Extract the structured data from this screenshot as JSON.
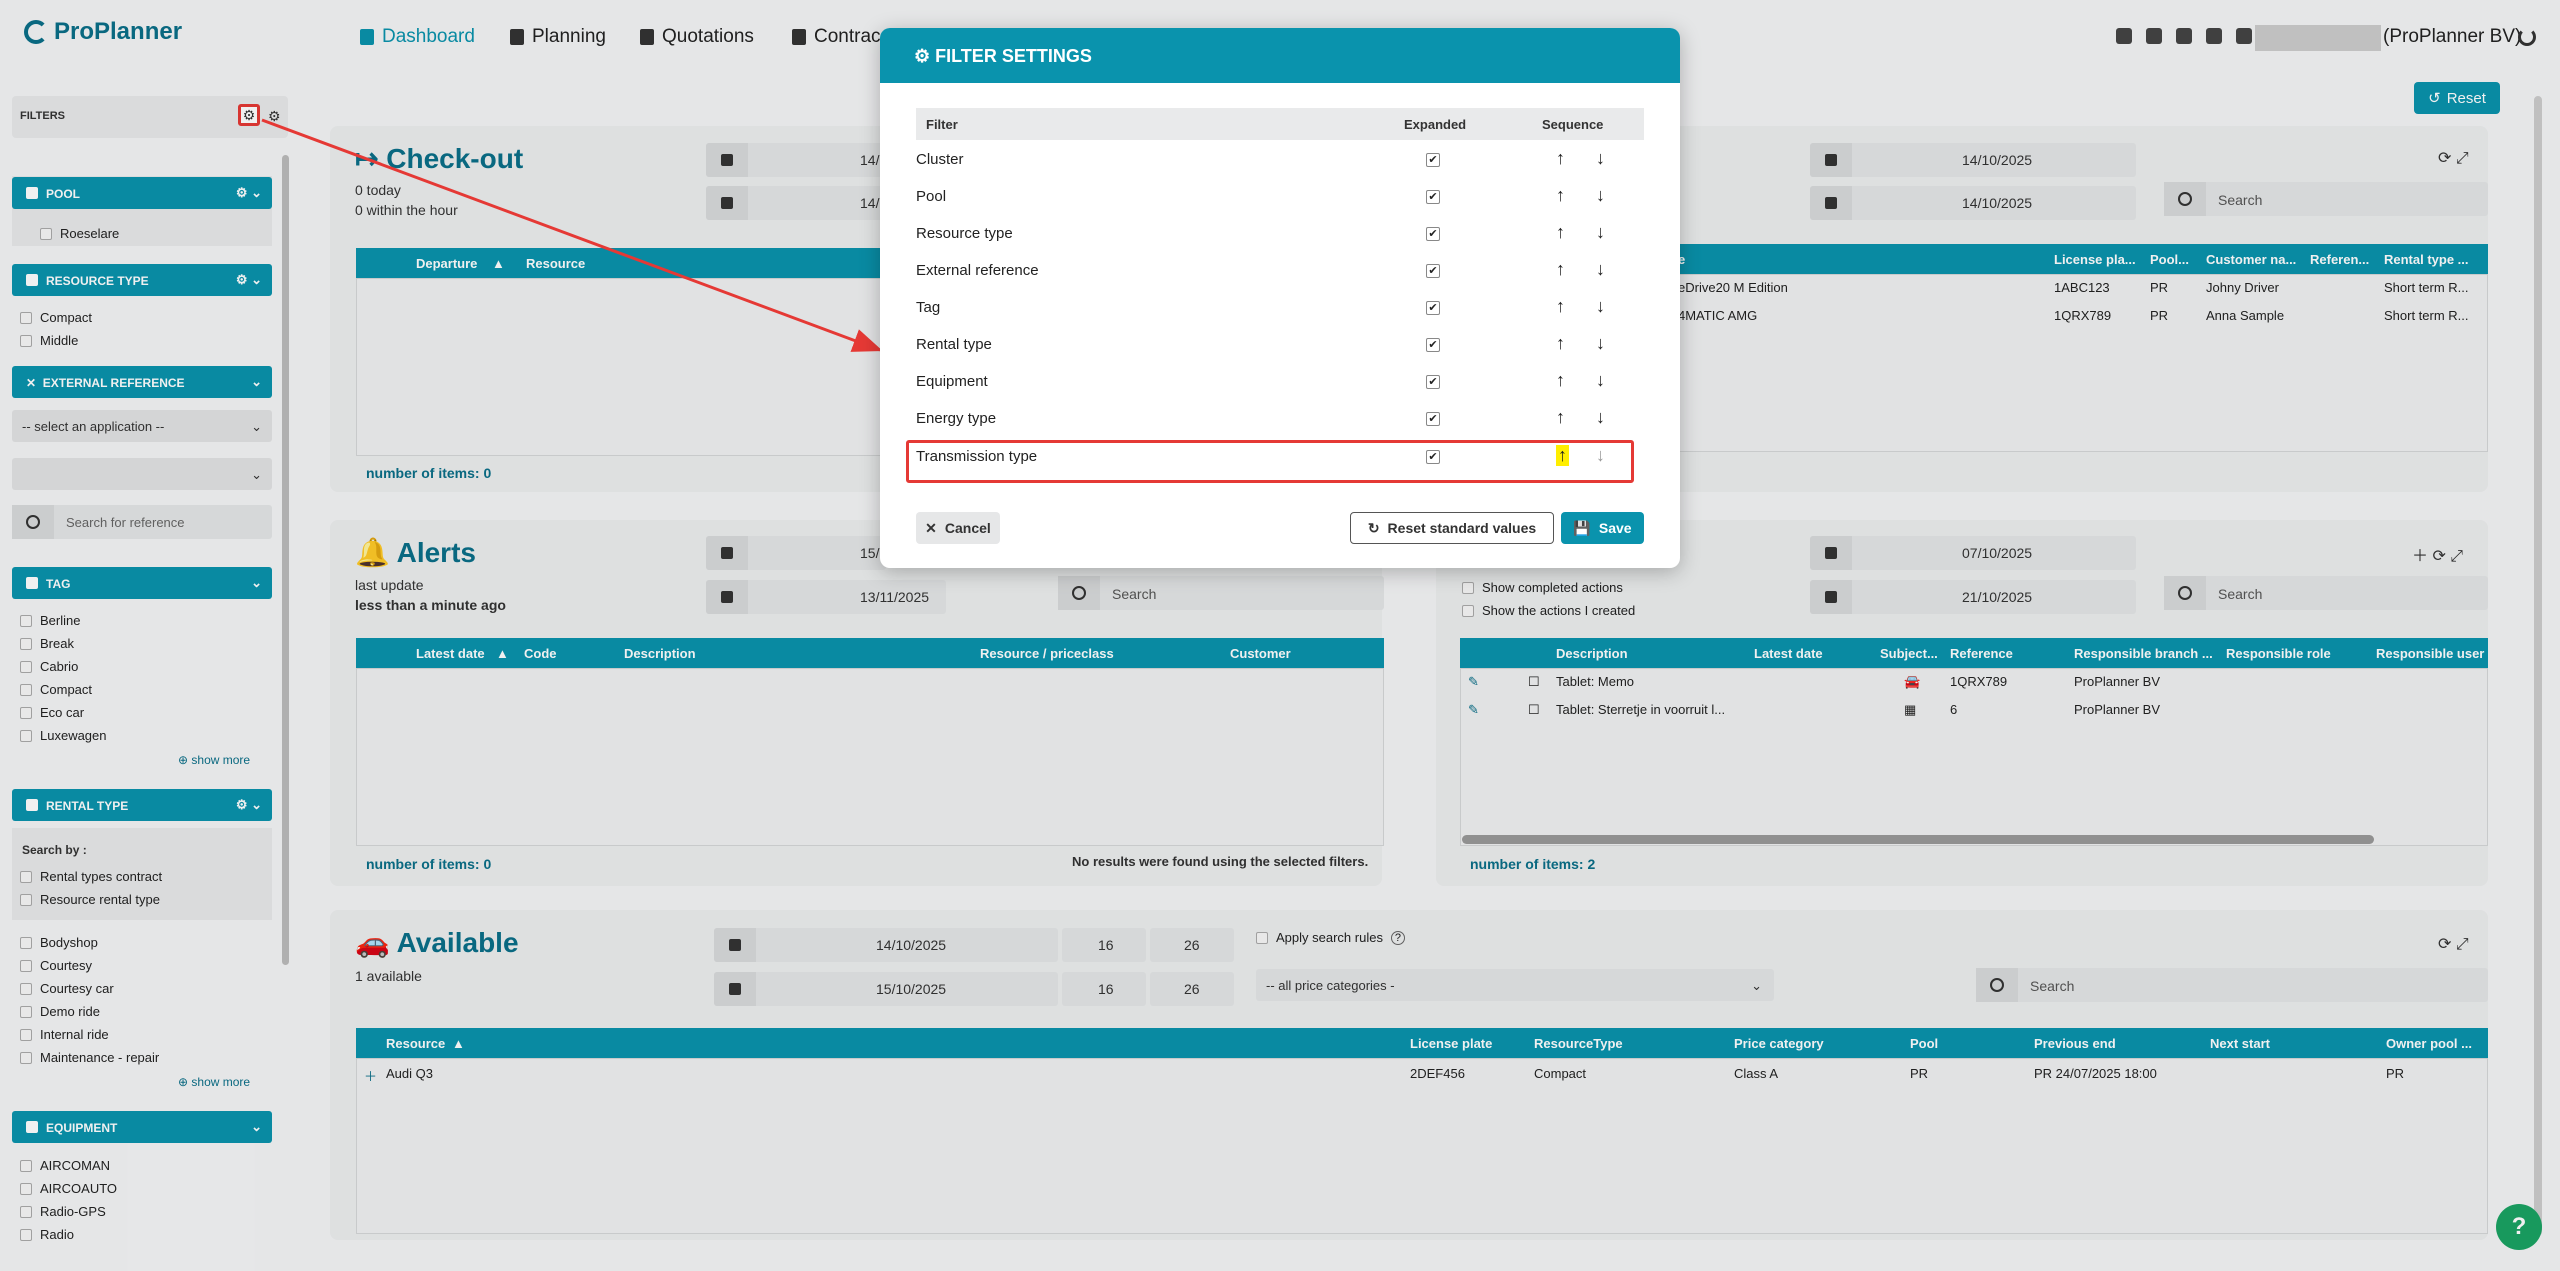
{
  "app": {
    "logo": "ProPlanner",
    "user": "(ProPlanner BV)"
  },
  "nav": [
    {
      "label": "Dashboard"
    },
    {
      "label": "Planning"
    },
    {
      "label": "Quotations"
    },
    {
      "label": "Contrac"
    }
  ],
  "toolbar": {
    "reset": "Reset"
  },
  "sidebar": {
    "title": "FILTERS",
    "pool": {
      "title": "POOL",
      "options": [
        "Roeselare"
      ]
    },
    "resource_type": {
      "title": "RESOURCE TYPE",
      "options": [
        "Compact",
        "Middle"
      ]
    },
    "external_reference": {
      "title": "EXTERNAL REFERENCE",
      "select": "-- select an application --",
      "search_placeholder": "Search for reference"
    },
    "tag": {
      "title": "TAG",
      "options": [
        "Berline",
        "Break",
        "Cabrio",
        "Compact",
        "Eco car",
        "Luxewagen"
      ],
      "show_more": "show more"
    },
    "rental_type": {
      "title": "RENTAL TYPE",
      "search_by": "Search by :",
      "search_opts": [
        "Rental types contract",
        "Resource rental type"
      ],
      "options": [
        "Bodyshop",
        "Courtesy",
        "Courtesy car",
        "Demo ride",
        "Internal ride",
        "Maintenance - repair"
      ],
      "show_more": "show more"
    },
    "equipment": {
      "title": "EQUIPMENT",
      "options": [
        "AIRCOMAN",
        "AIRCOAUTO",
        "Radio-GPS",
        "Radio"
      ]
    }
  },
  "checkout": {
    "title": "Check-out",
    "today": "0 today",
    "within": "0 within the hour",
    "date1": "14/(",
    "date2": "14/(",
    "cols": [
      "Departure",
      "Resource"
    ],
    "count": "number of items: 0"
  },
  "checkin": {
    "date1": "14/10/2025",
    "date2": "14/10/2025",
    "search": "Search",
    "cols": [
      "e",
      "License pla...",
      "Pool...",
      "Customer na...",
      "Referen...",
      "Rental type ..."
    ],
    "rows": [
      [
        "eDrive20 M Edition",
        "1ABC123",
        "PR",
        "Johny Driver",
        "",
        "Short term R..."
      ],
      [
        "4MATIC AMG",
        "1QRX789",
        "PR",
        "Anna Sample",
        "",
        "Short term R..."
      ]
    ]
  },
  "alerts": {
    "title": "Alerts",
    "last_update": "last update",
    "age": "less than a minute ago",
    "date1": "15/(",
    "date2": "13/11/2025",
    "search": "Search",
    "cols": [
      "Latest date",
      "Code",
      "Description",
      "Resource / priceclass",
      "Customer"
    ],
    "count": "number of items: 0",
    "empty": "No results were found using the selected filters."
  },
  "actions": {
    "show_completed": "Show completed actions",
    "show_mine": "Show the actions I created",
    "date1": "07/10/2025",
    "date2": "21/10/2025",
    "search": "Search",
    "cols": [
      "Description",
      "Latest date",
      "Subject...",
      "Reference",
      "Responsible branch ...",
      "Responsible role",
      "Responsible user"
    ],
    "rows": [
      [
        "Tablet: Memo",
        "",
        "",
        "1QRX789",
        "ProPlanner BV"
      ],
      [
        "Tablet: Sterretje in voorruit l...",
        "",
        "",
        "6",
        "ProPlanner BV"
      ]
    ],
    "count": "number of items: 2"
  },
  "available": {
    "title": "Available",
    "sub": "1 available",
    "date1": "14/10/2025",
    "h1": "16",
    "m1": "26",
    "date2": "15/10/2025",
    "h2": "16",
    "m2": "26",
    "apply_rules": "Apply search rules",
    "price_cat": "-- all price categories -",
    "search": "Search",
    "cols": [
      "Resource",
      "License plate",
      "ResourceType",
      "Price category",
      "Pool",
      "Previous end",
      "Next start",
      "Owner pool ..."
    ],
    "rows": [
      [
        "Audi Q3",
        "2DEF456",
        "Compact",
        "Class A",
        "PR",
        "PR 24/07/2025 18:00",
        "",
        "PR"
      ]
    ]
  },
  "modal": {
    "title": "FILTER SETTINGS",
    "col_filter": "Filter",
    "col_expanded": "Expanded",
    "col_sequence": "Sequence",
    "rows": [
      "Cluster",
      "Pool",
      "Resource type",
      "External reference",
      "Tag",
      "Rental type",
      "Equipment",
      "Energy type",
      "Transmission type"
    ],
    "cancel": "Cancel",
    "reset": "Reset standard values",
    "save": "Save"
  },
  "colors": {
    "accent": "#0a93ad",
    "highlight": "#e53935",
    "help": "#1aa363"
  }
}
